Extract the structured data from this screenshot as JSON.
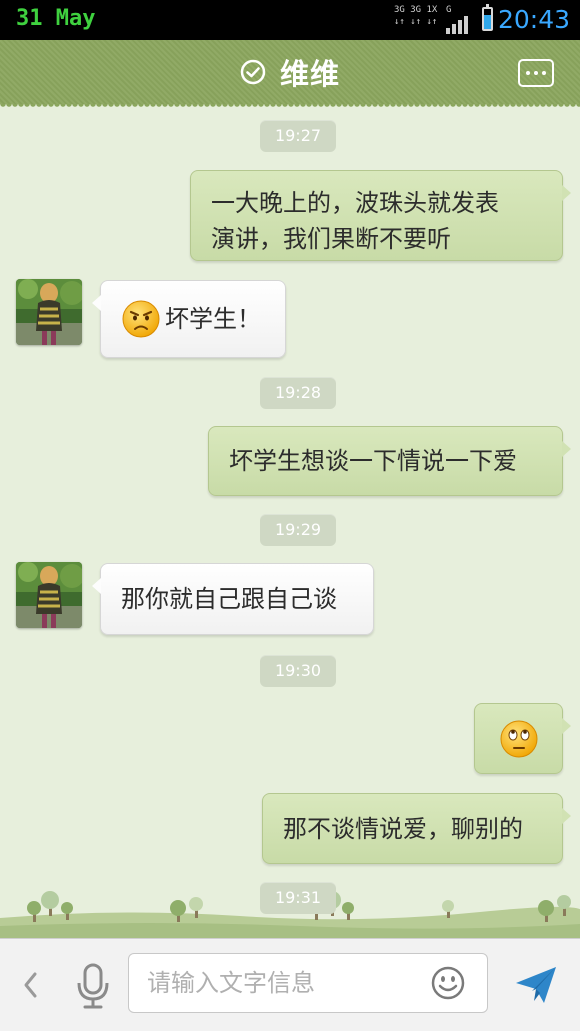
{
  "status_bar": {
    "date": "31 May",
    "network_top": "3G 3G 1X",
    "network_bottom": "↓↑ ↓↑ ↓↑",
    "signal_label": "G",
    "time": "20:43",
    "battery_level": 0.7
  },
  "header": {
    "title": "维维",
    "verified_icon": "check-circle-icon",
    "more_icon": "more-dots-icon"
  },
  "colors": {
    "title_bar": "#8ba65e",
    "chat_background": "#e7efdc",
    "outgoing_bubble": "#cfe0b0",
    "incoming_bubble": "#ffffff",
    "time_text": "#3aa8ff",
    "date_text": "#3fd13f"
  },
  "messages": [
    {
      "type": "timestamp",
      "text": "19:27"
    },
    {
      "type": "out",
      "text": "一大晚上的，波珠头就发表\n演讲，我们果断不要听"
    },
    {
      "type": "in",
      "emoji": "frown-face",
      "text": "坏学生！"
    },
    {
      "type": "timestamp",
      "text": "19:28"
    },
    {
      "type": "out",
      "text": "坏学生想谈一下情说一下爱"
    },
    {
      "type": "timestamp",
      "text": "19:29"
    },
    {
      "type": "in",
      "text": "那你就自己跟自己谈"
    },
    {
      "type": "timestamp",
      "text": "19:30"
    },
    {
      "type": "out",
      "emoji": "eye-roll-face",
      "text": ""
    },
    {
      "type": "out",
      "text": "那不谈情说爱，聊别的"
    },
    {
      "type": "timestamp",
      "text": "19:31"
    }
  ],
  "input_bar": {
    "placeholder": "请输入文字信息",
    "value": "",
    "back_icon": "chevron-left-icon",
    "mic_icon": "microphone-icon",
    "emoji_icon": "smiley-icon",
    "send_icon": "paper-plane-icon"
  }
}
